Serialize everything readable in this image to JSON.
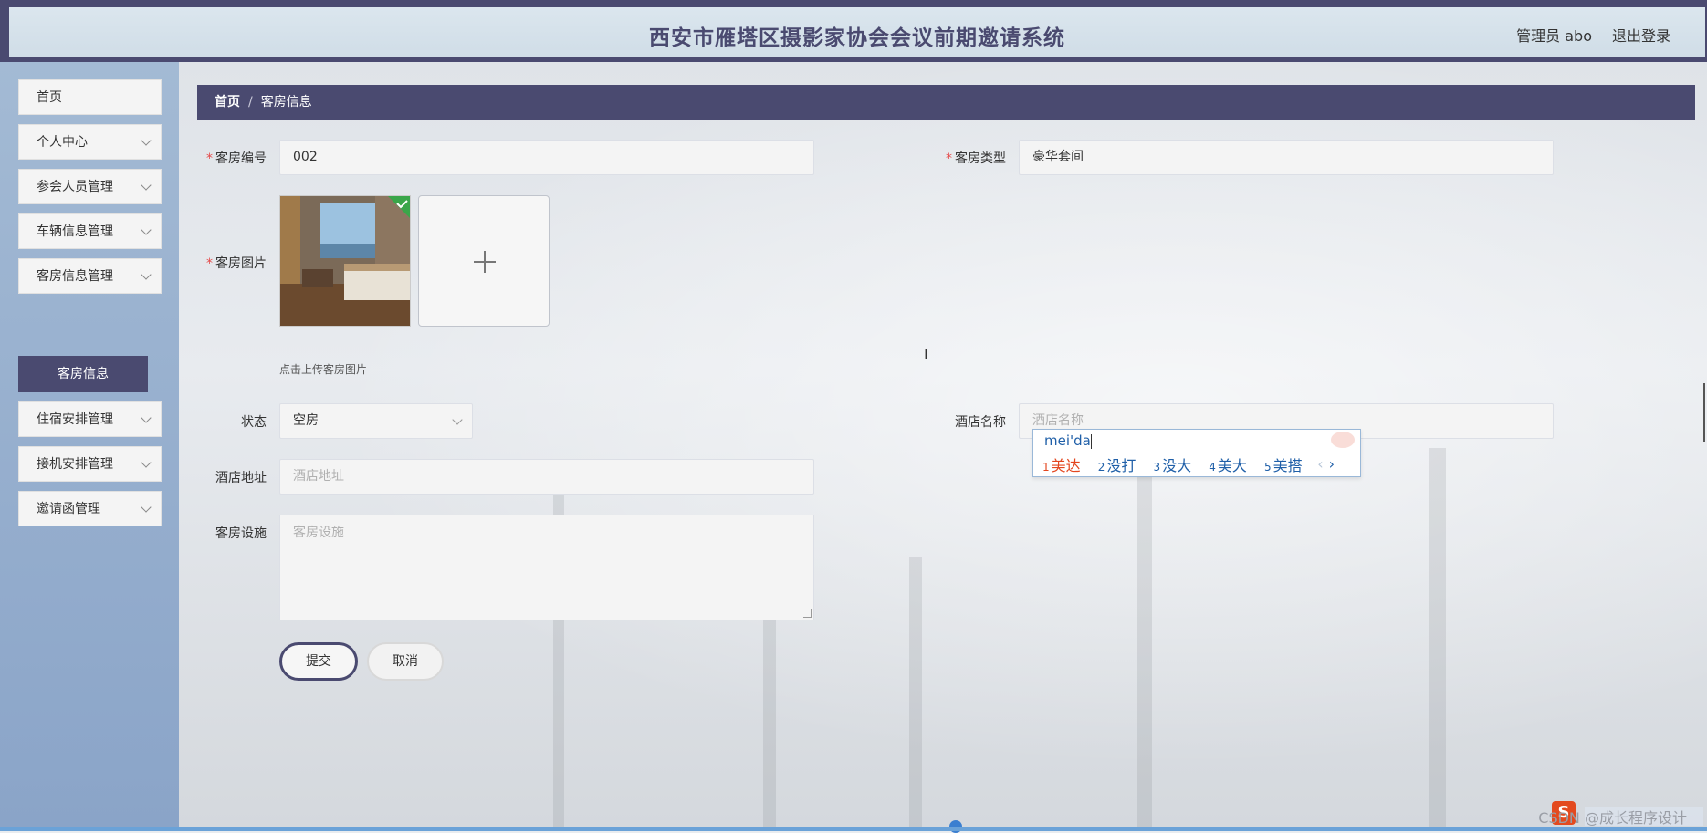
{
  "header": {
    "title": "西安市雁塔区摄影家协会会议前期邀请系统",
    "user": "管理员 abo",
    "logout": "退出登录"
  },
  "sidebar": {
    "items": [
      {
        "label": "首页",
        "has_children": false
      },
      {
        "label": "个人中心",
        "has_children": true
      },
      {
        "label": "参会人员管理",
        "has_children": true
      },
      {
        "label": "车辆信息管理",
        "has_children": true
      },
      {
        "label": "客房信息管理",
        "has_children": true
      },
      {
        "label": "住宿安排管理",
        "has_children": true
      },
      {
        "label": "接机安排管理",
        "has_children": true
      },
      {
        "label": "邀请函管理",
        "has_children": true
      }
    ],
    "active_subitem": "客房信息"
  },
  "breadcrumb": {
    "home": "首页",
    "separator": "/",
    "current": "客房信息"
  },
  "form": {
    "room_number": {
      "label": "客房编号",
      "value": "002",
      "required": true
    },
    "room_type": {
      "label": "客房类型",
      "value": "豪华套间",
      "required": true
    },
    "room_image": {
      "label": "客房图片",
      "required": true,
      "tip": "点击上传客房图片"
    },
    "status": {
      "label": "状态",
      "value": "空房"
    },
    "hotel_name": {
      "label": "酒店名称",
      "placeholder": "酒店名称"
    },
    "hotel_address": {
      "label": "酒店地址",
      "placeholder": "酒店地址"
    },
    "facilities": {
      "label": "客房设施",
      "placeholder": "客房设施"
    },
    "submit": "提交",
    "cancel": "取消"
  },
  "ime": {
    "composition": "mei'da",
    "candidates": [
      {
        "num": "1",
        "text": "美达"
      },
      {
        "num": "2",
        "text": "没打"
      },
      {
        "num": "3",
        "text": "没大"
      },
      {
        "num": "4",
        "text": "美大"
      },
      {
        "num": "5",
        "text": "美搭"
      }
    ],
    "prev": "‹",
    "next": "›"
  },
  "watermark": "CSDN @成长程序设计"
}
